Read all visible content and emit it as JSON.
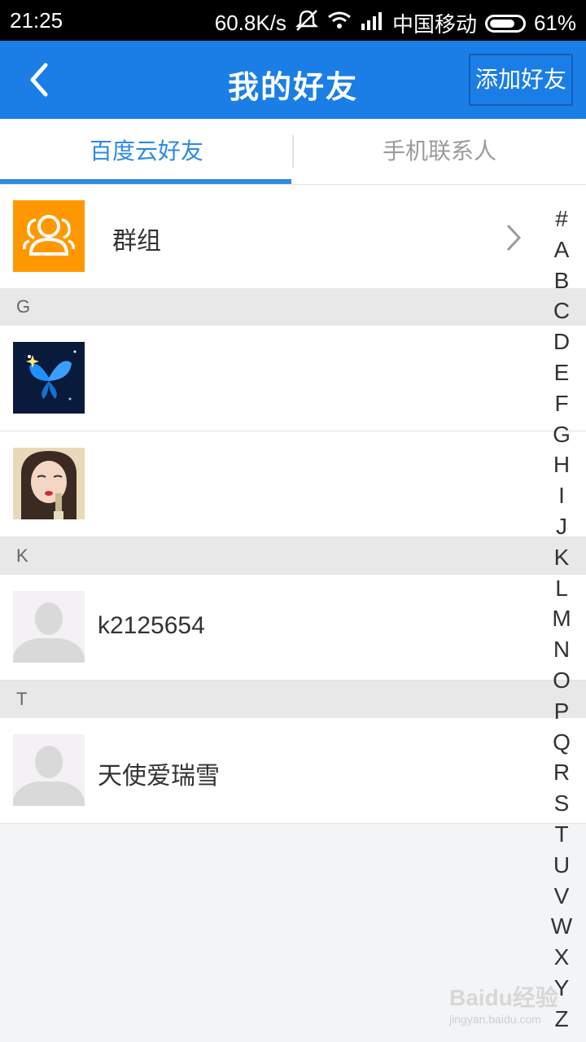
{
  "status_bar": {
    "time": "21:25",
    "network_speed": "60.8K/s",
    "carrier": "中国移动",
    "battery": "61%"
  },
  "header": {
    "title": "我的好友",
    "add_button": "添加好友"
  },
  "tabs": [
    {
      "label": "百度云好友",
      "active": true
    },
    {
      "label": "手机联系人",
      "active": false
    }
  ],
  "group_row": {
    "label": "群组"
  },
  "sections": [
    {
      "letter": "G",
      "friends": [
        {
          "name": ""
        },
        {
          "name": ""
        }
      ]
    },
    {
      "letter": "K",
      "friends": [
        {
          "name": "k2125654"
        }
      ]
    },
    {
      "letter": "T",
      "friends": [
        {
          "name": "天使爱瑞雪"
        }
      ]
    }
  ],
  "index_letters": [
    "#",
    "A",
    "B",
    "C",
    "D",
    "E",
    "F",
    "G",
    "H",
    "I",
    "J",
    "K",
    "L",
    "M",
    "N",
    "O",
    "P",
    "Q",
    "R",
    "S",
    "T",
    "U",
    "V",
    "W",
    "X",
    "Y",
    "Z"
  ],
  "watermark": {
    "brand": "Baidu经验",
    "url": "jingyan.baidu.com"
  },
  "colors": {
    "header_bg": "#1b7ee6",
    "accent": "#2c8be6",
    "group_icon_bg": "#ff9800"
  }
}
